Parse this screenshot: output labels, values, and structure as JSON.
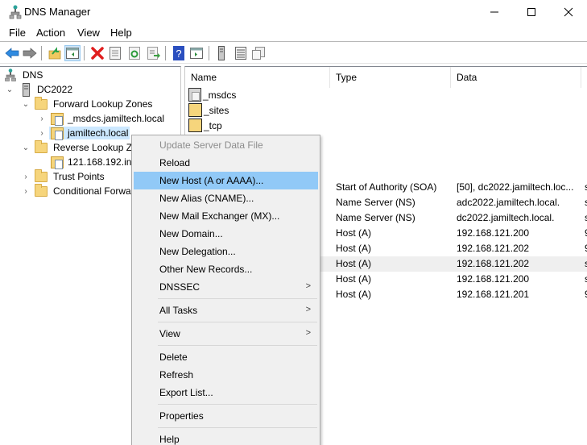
{
  "window": {
    "title": "DNS Manager",
    "minimize_glyph": "—",
    "maximize_glyph": "☐",
    "close_glyph": "✕"
  },
  "menubar": [
    "File",
    "Action",
    "View",
    "Help"
  ],
  "toolbar": [
    {
      "icon": "back-arrow-icon",
      "color": "#2f8ae0"
    },
    {
      "icon": "forward-arrow-icon",
      "color": "#7a7a7a"
    },
    {
      "icon": "up-folder-icon"
    },
    {
      "icon": "show-hide-console-tree-icon",
      "active": true
    },
    {
      "icon": "delete-icon",
      "color": "#e01e1e"
    },
    {
      "icon": "properties-icon"
    },
    {
      "icon": "refresh-icon"
    },
    {
      "icon": "export-list-icon"
    },
    {
      "icon": "help-icon",
      "color": "#2b4fbf"
    },
    {
      "icon": "show-action-pane-icon"
    },
    {
      "icon": "server-icon"
    },
    {
      "icon": "list-view-icon"
    },
    {
      "icon": "copy-icon"
    }
  ],
  "tree": {
    "items": [
      {
        "label": "DNS",
        "level": 0,
        "icon": "dns-icon",
        "chevron": ""
      },
      {
        "label": "DC2022",
        "level": 1,
        "icon": "server-icon",
        "chevron": "expanded"
      },
      {
        "label": "Forward Lookup Zones",
        "level": 2,
        "icon": "folder-icon",
        "chevron": "expanded"
      },
      {
        "label": "_msdcs.jamiltech.local",
        "level": 3,
        "icon": "zone-icon",
        "chevron": "collapsed"
      },
      {
        "label": "jamiltech.local",
        "level": 3,
        "icon": "zone-icon",
        "chevron": "collapsed",
        "selected": true
      },
      {
        "label": "Reverse Lookup Zo",
        "level": 2,
        "icon": "folder-icon",
        "chevron": "expanded"
      },
      {
        "label": "121.168.192.in-",
        "level": 3,
        "icon": "zone-icon",
        "chevron": ""
      },
      {
        "label": "Trust Points",
        "level": 2,
        "icon": "folder-icon",
        "chevron": "collapsed"
      },
      {
        "label": "Conditional Forwa",
        "level": 2,
        "icon": "folder-icon",
        "chevron": "collapsed"
      }
    ]
  },
  "list": {
    "columns": [
      "Name",
      "Type",
      "Data",
      "T"
    ],
    "rows": [
      {
        "name": "_msdcs",
        "icon": "file-icon",
        "type": "",
        "data": "",
        "extra": ""
      },
      {
        "name": "_sites",
        "icon": "folder-icon",
        "type": "",
        "data": "",
        "extra": ""
      },
      {
        "name": "_tcp",
        "icon": "folder-icon",
        "type": "",
        "data": "",
        "extra": ""
      },
      {
        "name": "",
        "icon": "",
        "type": "",
        "data": "",
        "extra": ""
      },
      {
        "name": "",
        "icon": "",
        "type": "",
        "data": "",
        "extra": ""
      },
      {
        "name": "",
        "icon": "",
        "type": "",
        "data": "",
        "extra": ""
      },
      {
        "name": "",
        "icon": "",
        "type": "Start of Authority (SOA)",
        "data": "[50], dc2022.jamiltech.loc...",
        "extra": "s"
      },
      {
        "name": "",
        "icon": "",
        "type": "Name Server (NS)",
        "data": "adc2022.jamiltech.local.",
        "extra": "s"
      },
      {
        "name": "",
        "icon": "",
        "type": "Name Server (NS)",
        "data": "dc2022.jamiltech.local.",
        "extra": "s"
      },
      {
        "name": "",
        "icon": "",
        "type": "Host (A)",
        "data": "192.168.121.200",
        "extra": "9"
      },
      {
        "name": "",
        "icon": "",
        "type": "Host (A)",
        "data": "192.168.121.202",
        "extra": "9"
      },
      {
        "name": "",
        "icon": "",
        "type": "Host (A)",
        "data": "192.168.121.202",
        "extra": "s",
        "highlighted": true
      },
      {
        "name": "",
        "icon": "",
        "type": "Host (A)",
        "data": "192.168.121.200",
        "extra": "s"
      },
      {
        "name": "",
        "icon": "",
        "type": "Host (A)",
        "data": "192.168.121.201",
        "extra": "9"
      }
    ]
  },
  "context_menu": {
    "items": [
      {
        "label": "Update Server Data File",
        "disabled": true
      },
      {
        "label": "Reload"
      },
      {
        "label": "New Host (A or AAAA)...",
        "hover": true
      },
      {
        "label": "New Alias (CNAME)..."
      },
      {
        "label": "New Mail Exchanger (MX)..."
      },
      {
        "label": "New Domain..."
      },
      {
        "label": "New Delegation..."
      },
      {
        "label": "Other New Records..."
      },
      {
        "label": "DNSSEC",
        "submenu": true
      },
      {
        "separator": true
      },
      {
        "label": "All Tasks",
        "submenu": true
      },
      {
        "separator": true
      },
      {
        "label": "View",
        "submenu": true
      },
      {
        "separator": true
      },
      {
        "label": "Delete"
      },
      {
        "label": "Refresh"
      },
      {
        "label": "Export List..."
      },
      {
        "separator": true
      },
      {
        "label": "Properties"
      },
      {
        "separator": true
      },
      {
        "label": "Help"
      }
    ],
    "submenu_glyph": ">"
  }
}
